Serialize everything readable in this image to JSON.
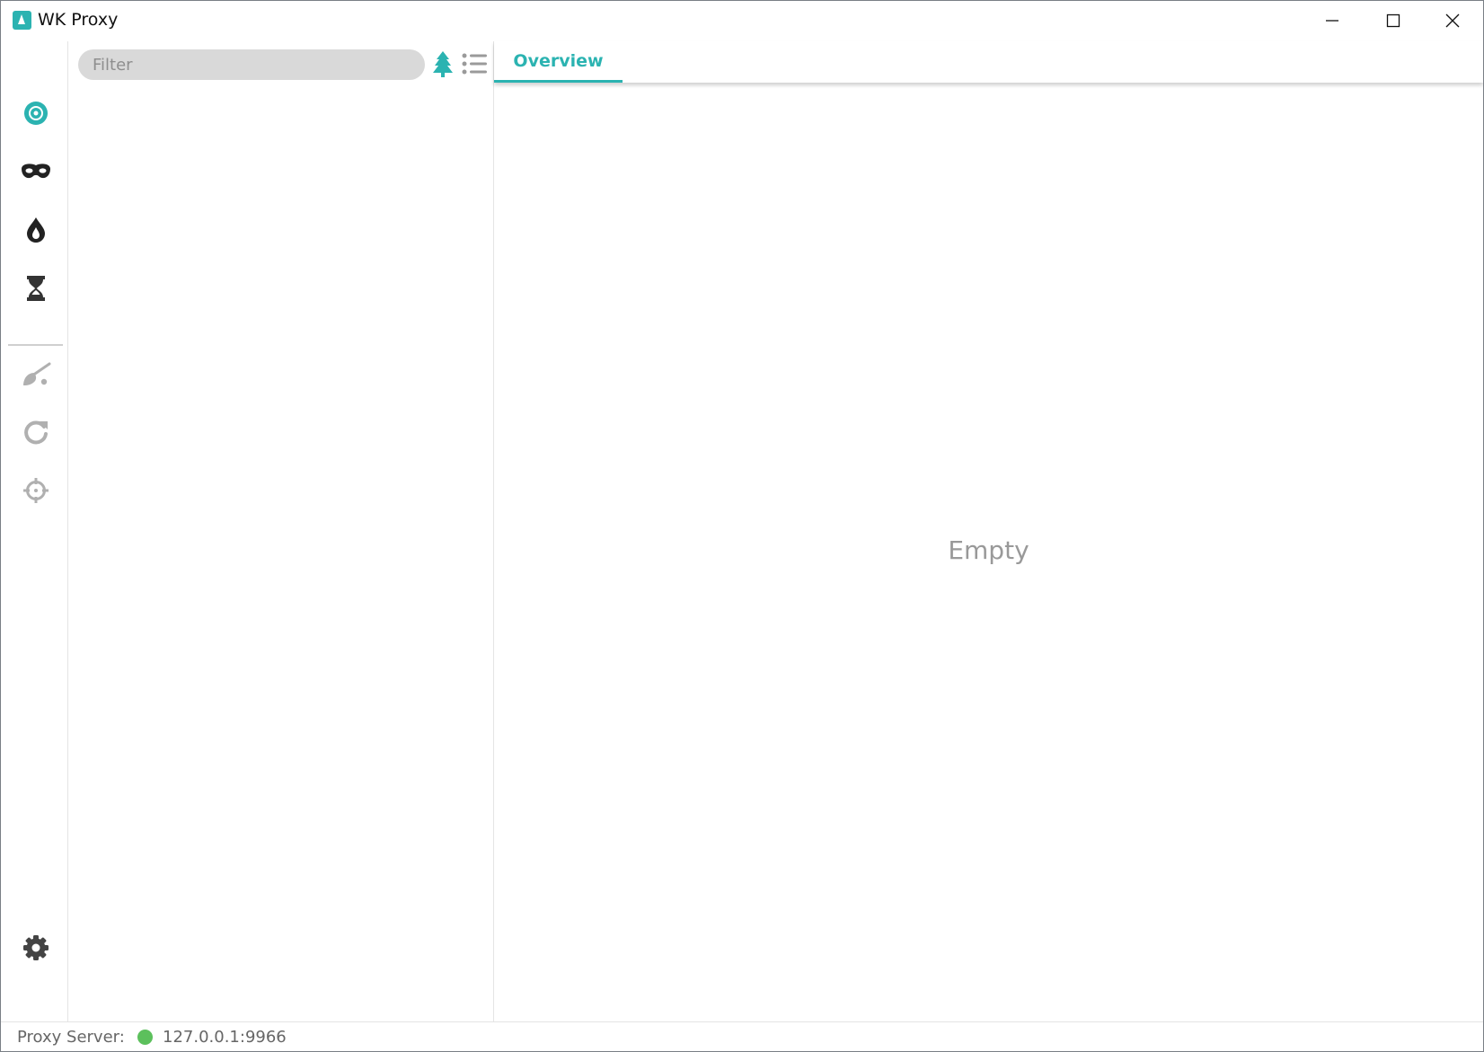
{
  "window": {
    "title": "WK Proxy",
    "controls": {
      "minimize": "minimize",
      "maximize": "maximize",
      "close": "close"
    }
  },
  "sidebar": {
    "items": [
      {
        "name": "target-icon",
        "color": "#2bb3b1",
        "active": true
      },
      {
        "name": "mask-icon",
        "color": "#222222"
      },
      {
        "name": "drop-icon",
        "color": "#222222"
      },
      {
        "name": "hourglass-icon",
        "color": "#333333"
      },
      {
        "name": "broom-icon",
        "color": "#b0b0b0"
      },
      {
        "name": "refresh-icon",
        "color": "#b0b0b0"
      },
      {
        "name": "crosshair-icon",
        "color": "#b0b0b0"
      }
    ],
    "settings_icon": "gear-icon"
  },
  "list": {
    "filter_placeholder": "Filter",
    "tree_view_icon": "tree-icon",
    "list_view_icon": "list-icon",
    "accent": "#2bb3b1"
  },
  "detail": {
    "tabs": [
      {
        "label": "Overview",
        "active": true
      }
    ],
    "empty_text": "Empty"
  },
  "status": {
    "label": "Proxy Server:",
    "state_color": "#5cc05c",
    "address": "127.0.0.1:9966"
  }
}
